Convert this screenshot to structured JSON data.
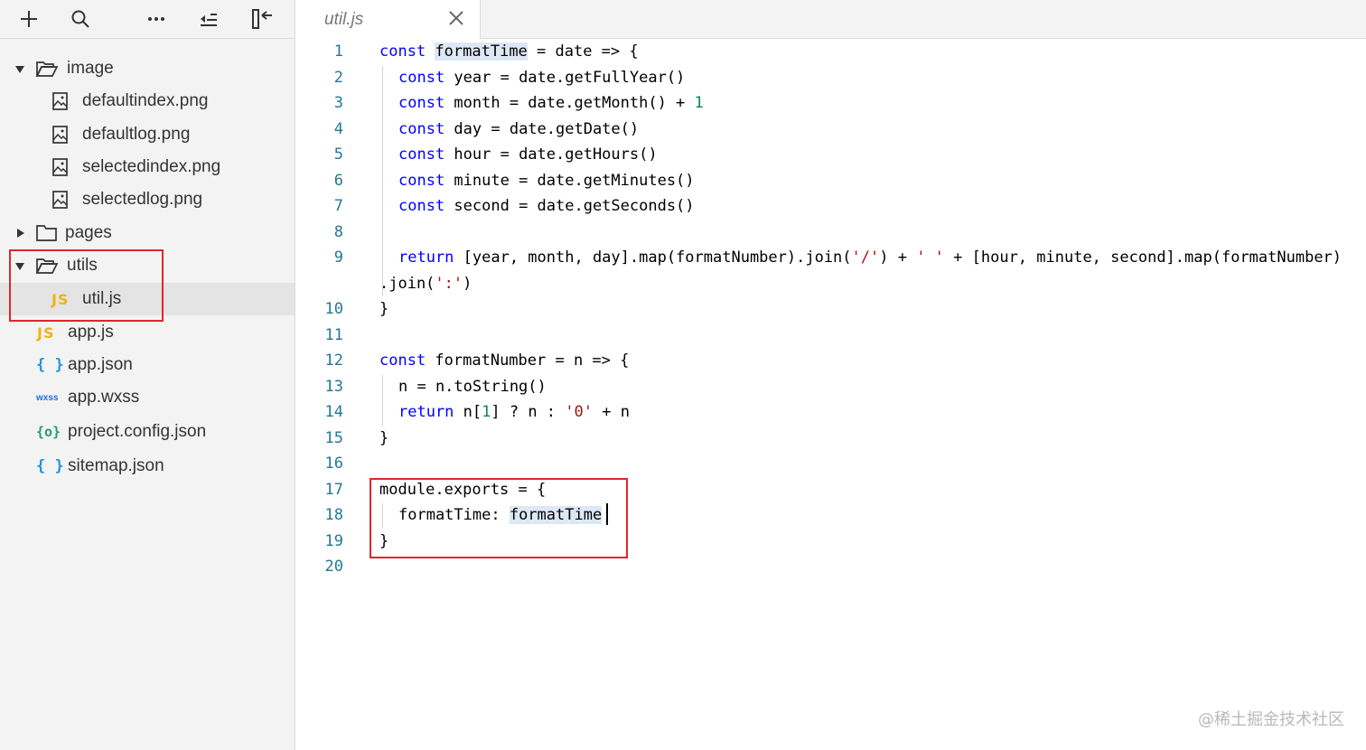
{
  "toolbar": {
    "icons": [
      "plus-icon",
      "search-icon",
      "more-icon",
      "collapse-outline-icon",
      "collapse-sidebar-icon"
    ]
  },
  "tree": {
    "image_folder": "image",
    "image_files": [
      "defaultindex.png",
      "defaultlog.png",
      "selectedindex.png",
      "selectedlog.png"
    ],
    "pages_folder": "pages",
    "utils_folder": "utils",
    "util_js": "util.js",
    "root_files": {
      "app_js": "app.js",
      "app_json": "app.json",
      "app_wxss": "app.wxss",
      "project_config": "project.config.json",
      "sitemap": "sitemap.json"
    },
    "icon_text": {
      "js": "JS",
      "json": "{ }",
      "wxss": "wxss",
      "config": "{o}"
    }
  },
  "editor": {
    "tab_title": "util.js",
    "line_numbers": [
      "1",
      "2",
      "3",
      "4",
      "5",
      "6",
      "7",
      "8",
      "9",
      "10",
      "11",
      "12",
      "13",
      "14",
      "15",
      "16",
      "17",
      "18",
      "19",
      "20"
    ],
    "code": {
      "l1": [
        "const",
        " ",
        "formatTime",
        " = date => {"
      ],
      "l2": [
        "const",
        " year = date.getFullYear()"
      ],
      "l3": [
        "const",
        " month = date.getMonth() + ",
        "1"
      ],
      "l4": [
        "const",
        " day = date.getDate()"
      ],
      "l5": [
        "const",
        " hour = date.getHours()"
      ],
      "l6": [
        "const",
        " minute = date.getMinutes()"
      ],
      "l7": [
        "const",
        " second = date.getSeconds()"
      ],
      "l9": [
        "return",
        " [year, month, day].map(formatNumber).join(",
        "'/'",
        ") + ",
        "' '",
        " + [hour, minute, second].map(formatNumber)"
      ],
      "l9b": [
        ".join(",
        "':'",
        ")"
      ],
      "l10": "}",
      "l12": [
        "const",
        " formatNumber = n => {"
      ],
      "l13": "n = n.toString()",
      "l14": [
        "return",
        " n[",
        "1",
        "] ? n : ",
        "'0'",
        " + n"
      ],
      "l15": "}",
      "l17": "module.exports = {",
      "l18": [
        "formatTime: ",
        "formatTime"
      ],
      "l19": "}"
    }
  },
  "watermark": "@稀土掘金技术社区",
  "colors": {
    "keyword": "#0000ff",
    "string": "#a31515",
    "number": "#098658",
    "line_number": "#237893",
    "annotation_box": "#e0262c"
  }
}
